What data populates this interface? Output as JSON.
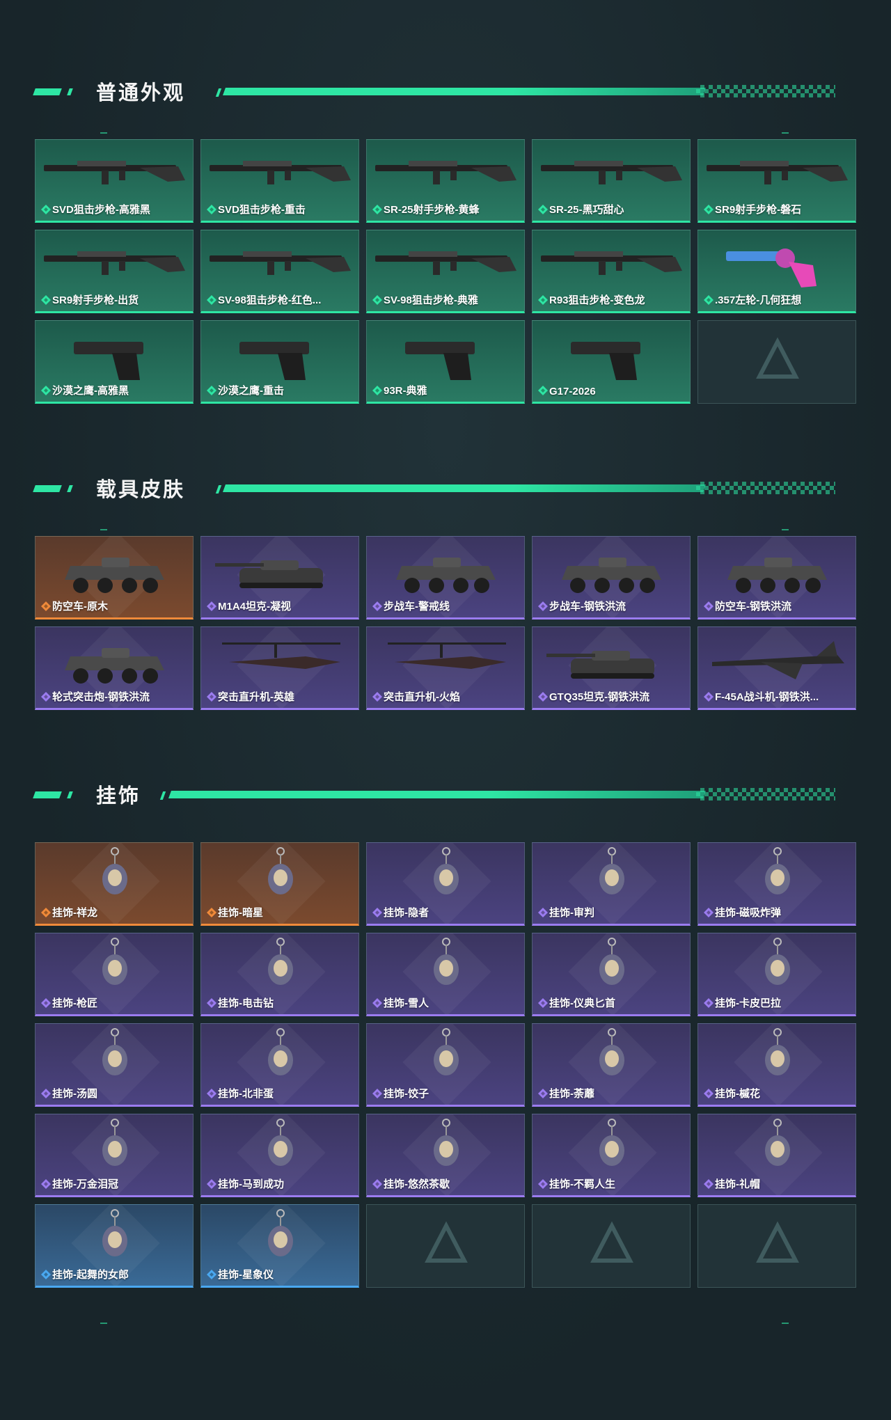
{
  "colors": {
    "accent": "#2ee6a4",
    "green_rarity": "#2ee6a4",
    "orange_rarity": "#f08a3a",
    "purple_rarity": "#9b7cf0",
    "blue_rarity": "#4aa8f0"
  },
  "sections": [
    {
      "title": "普通外观",
      "items": [
        {
          "label": "SVD狙击步枪-高雅黑",
          "rarity": "green",
          "icon": "sniper-rifle-icon"
        },
        {
          "label": "SVD狙击步枪-重击",
          "rarity": "green",
          "icon": "sniper-rifle-icon"
        },
        {
          "label": "SR-25射手步枪-黄蜂",
          "rarity": "green",
          "icon": "rifle-icon"
        },
        {
          "label": "SR-25-黑巧甜心",
          "rarity": "green",
          "icon": "rifle-icon"
        },
        {
          "label": "SR9射手步枪-磐石",
          "rarity": "green",
          "icon": "rifle-icon"
        },
        {
          "label": "SR9射手步枪-出货",
          "rarity": "green",
          "icon": "rifle-icon"
        },
        {
          "label": "SV-98狙击步枪-红色...",
          "rarity": "green",
          "icon": "sniper-rifle-icon"
        },
        {
          "label": "SV-98狙击步枪-典雅",
          "rarity": "green",
          "icon": "sniper-rifle-icon"
        },
        {
          "label": "R93狙击步枪-变色龙",
          "rarity": "green",
          "icon": "sniper-rifle-icon"
        },
        {
          "label": ".357左轮-几何狂想",
          "rarity": "green",
          "icon": "revolver-icon"
        },
        {
          "label": "沙漠之鹰-高雅黑",
          "rarity": "green",
          "icon": "pistol-icon"
        },
        {
          "label": "沙漠之鹰-重击",
          "rarity": "green",
          "icon": "pistol-icon"
        },
        {
          "label": "93R-典雅",
          "rarity": "green",
          "icon": "pistol-icon"
        },
        {
          "label": "G17-2026",
          "rarity": "green",
          "icon": "pistol-icon"
        },
        {
          "label": "",
          "rarity": "empty",
          "icon": "placeholder-logo-icon"
        }
      ]
    },
    {
      "title": "载具皮肤",
      "items": [
        {
          "label": "防空车-原木",
          "rarity": "orange",
          "icon": "armored-vehicle-icon"
        },
        {
          "label": "M1A4坦克-凝视",
          "rarity": "purple",
          "icon": "tank-icon"
        },
        {
          "label": "步战车-警戒线",
          "rarity": "purple",
          "icon": "armored-vehicle-icon"
        },
        {
          "label": "步战车-钢铁洪流",
          "rarity": "purple",
          "icon": "armored-vehicle-icon"
        },
        {
          "label": "防空车-钢铁洪流",
          "rarity": "purple",
          "icon": "armored-vehicle-icon"
        },
        {
          "label": "轮式突击炮-钢铁洪流",
          "rarity": "purple",
          "icon": "assault-vehicle-icon"
        },
        {
          "label": "突击直升机-英雄",
          "rarity": "purple",
          "icon": "helicopter-icon"
        },
        {
          "label": "突击直升机-火焰",
          "rarity": "purple",
          "icon": "helicopter-icon"
        },
        {
          "label": "GTQ35坦克-钢铁洪流",
          "rarity": "purple",
          "icon": "tank-icon"
        },
        {
          "label": "F-45A战斗机-钢铁洪...",
          "rarity": "purple",
          "icon": "fighter-jet-icon"
        }
      ]
    },
    {
      "title": "挂饰",
      "items": [
        {
          "label": "挂饰-祥龙",
          "rarity": "orange",
          "icon": "charm-icon"
        },
        {
          "label": "挂饰-暗星",
          "rarity": "orange",
          "icon": "charm-icon"
        },
        {
          "label": "挂饰-隐者",
          "rarity": "purple",
          "icon": "charm-icon"
        },
        {
          "label": "挂饰-审判",
          "rarity": "purple",
          "icon": "charm-icon"
        },
        {
          "label": "挂饰-磁吸炸弹",
          "rarity": "purple",
          "icon": "charm-icon"
        },
        {
          "label": "挂饰-枪匠",
          "rarity": "purple",
          "icon": "charm-icon"
        },
        {
          "label": "挂饰-电击钻",
          "rarity": "purple",
          "icon": "charm-icon"
        },
        {
          "label": "挂饰-雪人",
          "rarity": "purple",
          "icon": "charm-icon"
        },
        {
          "label": "挂饰-仪典匕首",
          "rarity": "purple",
          "icon": "charm-icon"
        },
        {
          "label": "挂饰-卡皮巴拉",
          "rarity": "purple",
          "icon": "charm-icon"
        },
        {
          "label": "挂饰-汤圆",
          "rarity": "purple",
          "icon": "charm-icon"
        },
        {
          "label": "挂饰-北非蛋",
          "rarity": "purple",
          "icon": "charm-icon"
        },
        {
          "label": "挂饰-饺子",
          "rarity": "purple",
          "icon": "charm-icon"
        },
        {
          "label": "挂饰-荼蘼",
          "rarity": "purple",
          "icon": "charm-icon"
        },
        {
          "label": "挂饰-槭花",
          "rarity": "purple",
          "icon": "charm-icon"
        },
        {
          "label": "挂饰-万金泪冠",
          "rarity": "purple",
          "icon": "charm-icon"
        },
        {
          "label": "挂饰-马到成功",
          "rarity": "purple",
          "icon": "charm-icon"
        },
        {
          "label": "挂饰-悠然茶歇",
          "rarity": "purple",
          "icon": "charm-icon"
        },
        {
          "label": "挂饰-不羁人生",
          "rarity": "purple",
          "icon": "charm-icon"
        },
        {
          "label": "挂饰-礼帽",
          "rarity": "purple",
          "icon": "charm-icon"
        },
        {
          "label": "挂饰-起舞的女郎",
          "rarity": "blue",
          "icon": "charm-icon"
        },
        {
          "label": "挂饰-星象仪",
          "rarity": "blue",
          "icon": "charm-icon"
        },
        {
          "label": "",
          "rarity": "empty",
          "icon": "placeholder-logo-icon"
        },
        {
          "label": "",
          "rarity": "empty",
          "icon": "placeholder-logo-icon"
        },
        {
          "label": "",
          "rarity": "empty",
          "icon": "placeholder-logo-icon"
        }
      ]
    }
  ]
}
